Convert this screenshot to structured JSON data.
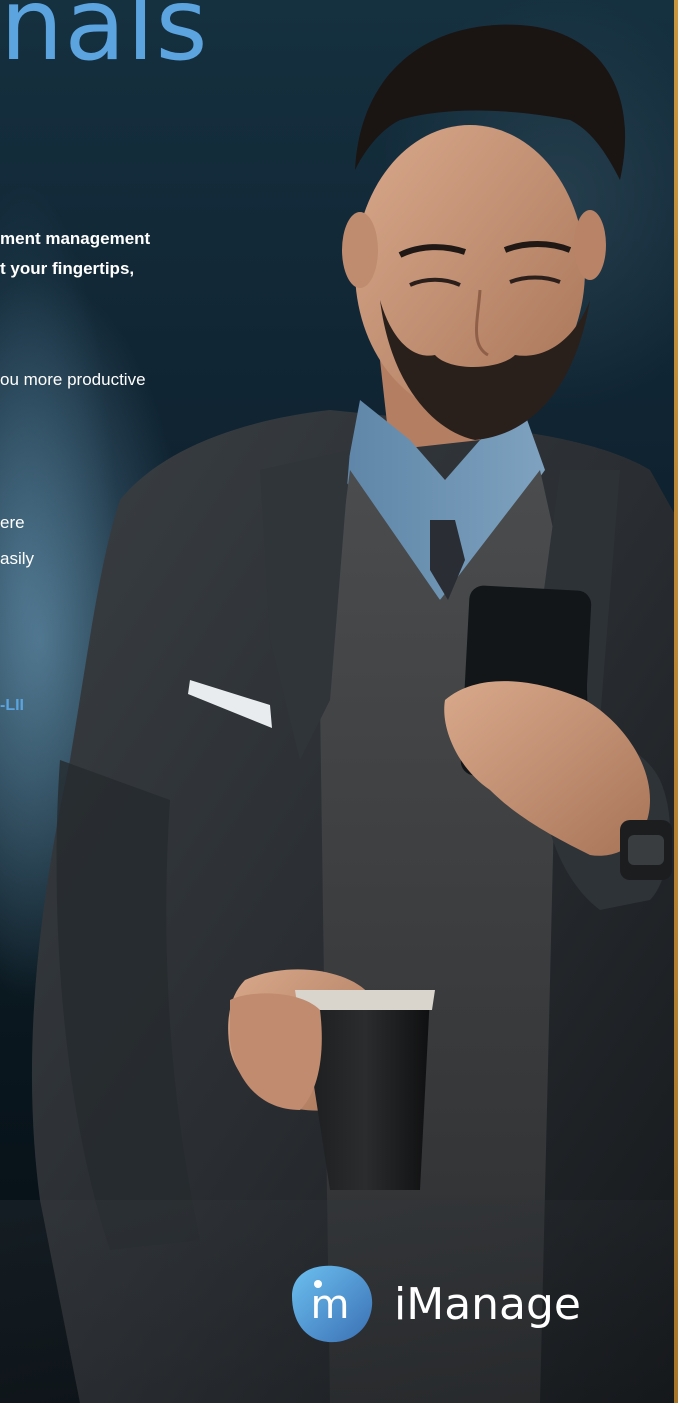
{
  "headline": {
    "text": "nals"
  },
  "intro": {
    "line1": "ment management",
    "line2": "t your fingertips,"
  },
  "body": {
    "line1": "ou more productive",
    "line2": "ere",
    "line3": "asily",
    "highlight": "-LII"
  },
  "brand": {
    "name": "iManage",
    "mark_letter": "m",
    "accent": "#5ba4df",
    "edge_color": "#c8963e"
  },
  "icons": {
    "logo": "imanage-logo-icon"
  }
}
